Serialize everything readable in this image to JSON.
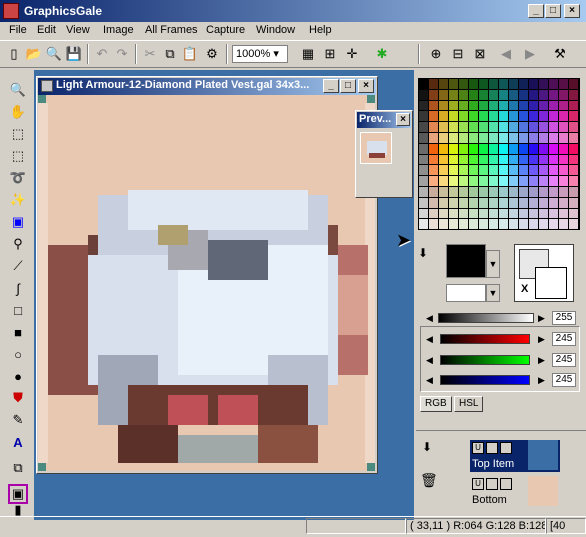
{
  "window": {
    "title": "GraphicsGale",
    "min": "_",
    "max": "□",
    "close": "×"
  },
  "menu": [
    "File",
    "Edit",
    "View",
    "Image",
    "All Frames",
    "Capture",
    "Window",
    "Help"
  ],
  "toolbar": {
    "zoom": "1000%"
  },
  "document": {
    "title": "Light Armour-12-Diamond Plated Vest.gal 34x3..."
  },
  "preview": {
    "title": "Prev..."
  },
  "colors": {
    "fg": "#000000",
    "bg": "#ffffff",
    "accent_title": "#0a246a",
    "mdi_bg": "#3a6ea5",
    "canvas_bg": "#e8c8b0"
  },
  "sliders": {
    "gray": "255",
    "r": "245",
    "g": "245",
    "b": "245"
  },
  "tabs": [
    "RGB",
    "HSL"
  ],
  "layers": [
    {
      "name": "Top Item",
      "selected": true
    },
    {
      "name": "Bottom",
      "selected": false
    }
  ],
  "status": {
    "coords": "( 33,11 ) R:064 G:128 B:128",
    "extra": "[40"
  }
}
